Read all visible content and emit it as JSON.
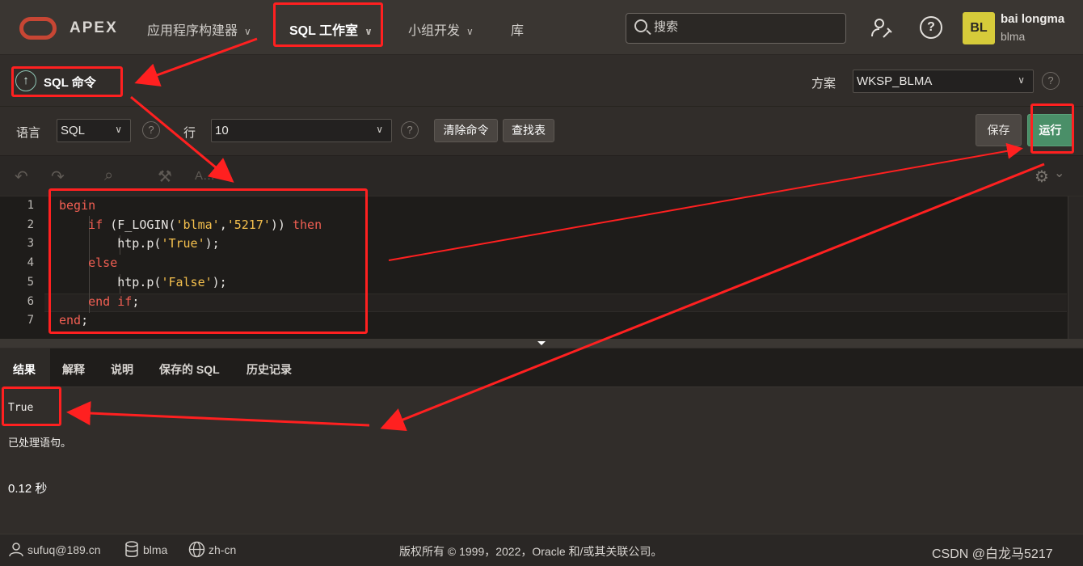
{
  "header": {
    "brand": "APEX",
    "nav": [
      {
        "label": "应用程序构建器",
        "chevron": true
      },
      {
        "label": "SQL 工作室",
        "chevron": true,
        "active": true
      },
      {
        "label": "小组开发",
        "chevron": true
      },
      {
        "label": "库",
        "chevron": false
      }
    ],
    "search_placeholder": "搜索",
    "help_glyph": "?",
    "user": {
      "initials": "BL",
      "name": "bai longma",
      "schema": "blma"
    }
  },
  "title_bar": {
    "up_glyph": "↑",
    "title": "SQL 命令",
    "schema_label": "方案",
    "schema_value": "WKSP_BLMA",
    "help_glyph": "?"
  },
  "toolbar": {
    "language_label": "语言",
    "language_value": "SQL",
    "rows_label": "行",
    "rows_value": "10",
    "help_glyph": "?",
    "clear_label": "清除命令",
    "find_table_label": "查找表",
    "save_label": "保存",
    "run_label": "运行"
  },
  "editor_toolbar": {
    "undo_glyph": "↶",
    "redo_glyph": "↷",
    "find_glyph": "⌕",
    "format_glyph": "⚒",
    "autocomplete_glyph": "A…",
    "settings_glyph": "⚙",
    "settings_chevron": "⌄"
  },
  "editor": {
    "line_numbers": [
      "1",
      "2",
      "3",
      "4",
      "5",
      "6",
      "7"
    ],
    "lines": [
      [
        {
          "t": "begin",
          "c": "kw"
        }
      ],
      [
        {
          "t": "    ",
          "c": ""
        },
        {
          "t": "if",
          "c": "kw"
        },
        {
          "t": " (F_LOGIN(",
          "c": "fn"
        },
        {
          "t": "'blma'",
          "c": "str"
        },
        {
          "t": ",",
          "c": "fn"
        },
        {
          "t": "'5217'",
          "c": "str"
        },
        {
          "t": ")) ",
          "c": "fn"
        },
        {
          "t": "then",
          "c": "kw"
        }
      ],
      [
        {
          "t": "        htp.p(",
          "c": "fn"
        },
        {
          "t": "'True'",
          "c": "str"
        },
        {
          "t": ");",
          "c": "fn"
        }
      ],
      [
        {
          "t": "    ",
          "c": ""
        },
        {
          "t": "else",
          "c": "kw"
        }
      ],
      [
        {
          "t": "        htp.p(",
          "c": "fn"
        },
        {
          "t": "'False'",
          "c": "str"
        },
        {
          "t": ");",
          "c": "fn"
        }
      ],
      [
        {
          "t": "    ",
          "c": ""
        },
        {
          "t": "end if",
          "c": "kw"
        },
        {
          "t": ";",
          "c": "fn"
        }
      ],
      [
        {
          "t": "end",
          "c": "kw"
        },
        {
          "t": ";",
          "c": "fn"
        }
      ]
    ]
  },
  "results": {
    "tabs": [
      "结果",
      "解释",
      "说明",
      "保存的 SQL",
      "历史记录"
    ],
    "output_lines": [
      "True",
      "已处理语句。"
    ],
    "elapsed": "0.12 秒"
  },
  "footer": {
    "email": "sufuq@189.cn",
    "workspace": "blma",
    "locale": "zh-cn",
    "copyright": "版权所有 © 1999，2022，Oracle 和/或其关联公司。",
    "watermark": "CSDN @白龙马5217"
  },
  "colors": {
    "accent_red": "#c74634",
    "keyword": "#f25f53",
    "string": "#f5c04d",
    "run_button": "#4a8f68",
    "annotation": "#ff2020"
  }
}
